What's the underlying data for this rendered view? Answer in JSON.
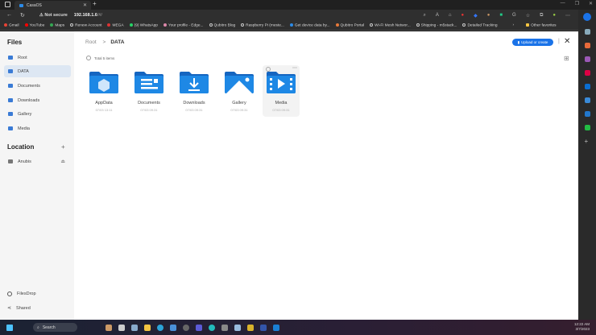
{
  "browser": {
    "tab_title": "CasaOS",
    "security": "Not secure",
    "url": "192.168.1.6",
    "url_suffix": "/#/",
    "bookmarks": [
      "Gmail",
      "YouTube",
      "Maps",
      "Renew Account",
      "MEGA",
      "(9) WhatsApp",
      "Your profile - Edge...",
      "Qubitro Blog",
      "Raspberry Pi (meste...",
      "Get device data by...",
      "Qubitro Portal",
      "Wi-Fi Mesh Networ...",
      "Shipping - m5stack...",
      "Detailed Tracking",
      "Other favorites"
    ]
  },
  "sidebar": {
    "title": "Files",
    "items": [
      {
        "label": "Root"
      },
      {
        "label": "DATA"
      },
      {
        "label": "Documents"
      },
      {
        "label": "Downloads"
      },
      {
        "label": "Gallery"
      },
      {
        "label": "Media"
      }
    ],
    "location_title": "Location",
    "add": "+",
    "locations": [
      {
        "label": "Anubis"
      }
    ],
    "footer": [
      {
        "label": "FilesDrop"
      },
      {
        "label": "Shared"
      }
    ]
  },
  "main": {
    "breadcrumb": [
      "Root",
      "DATA"
    ],
    "separator": ">",
    "upload_label": "Upload or create",
    "total": "Total 5 items",
    "files": [
      {
        "name": "AppData",
        "date": "07/03 13:11"
      },
      {
        "name": "Documents",
        "date": "07/03 09:31"
      },
      {
        "name": "Downloads",
        "date": "07/03 09:31"
      },
      {
        "name": "Gallery",
        "date": "07/03 09:31"
      },
      {
        "name": "Media",
        "date": "07/03 09:31"
      }
    ]
  },
  "taskbar": {
    "search": "Search",
    "time": "12:22 AM",
    "date": "3/7/2023"
  },
  "colors": {
    "accent": "#1a73e8",
    "folder": "#1e88e5"
  }
}
